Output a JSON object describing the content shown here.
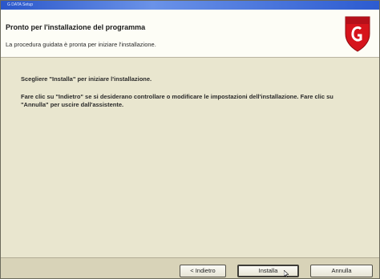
{
  "window": {
    "title": "G DATA Setup"
  },
  "header": {
    "title": "Pronto per l'installazione del programma",
    "subtitle": "La procedura guidata è pronta per iniziare l'installazione."
  },
  "content": {
    "line1": "Scegliere \"Installa\" per iniziare l'installazione.",
    "line2": "Fare clic su \"Indietro\" se si desiderano controllare o modificare le impostazioni dell'installazione. Fare clic su \"Annulla\" per uscire dall'assistente."
  },
  "buttons": {
    "back_label": "< Indietro",
    "install_label": "Installa",
    "cancel_label": "Annulla"
  },
  "icons": {
    "logo": "gdata-shield-logo",
    "cursor": "mouse-pointer-icon"
  },
  "colors": {
    "title_bar": "#2a56c9",
    "logo_red": "#d6141c",
    "content_bg": "#e9e6cf"
  }
}
